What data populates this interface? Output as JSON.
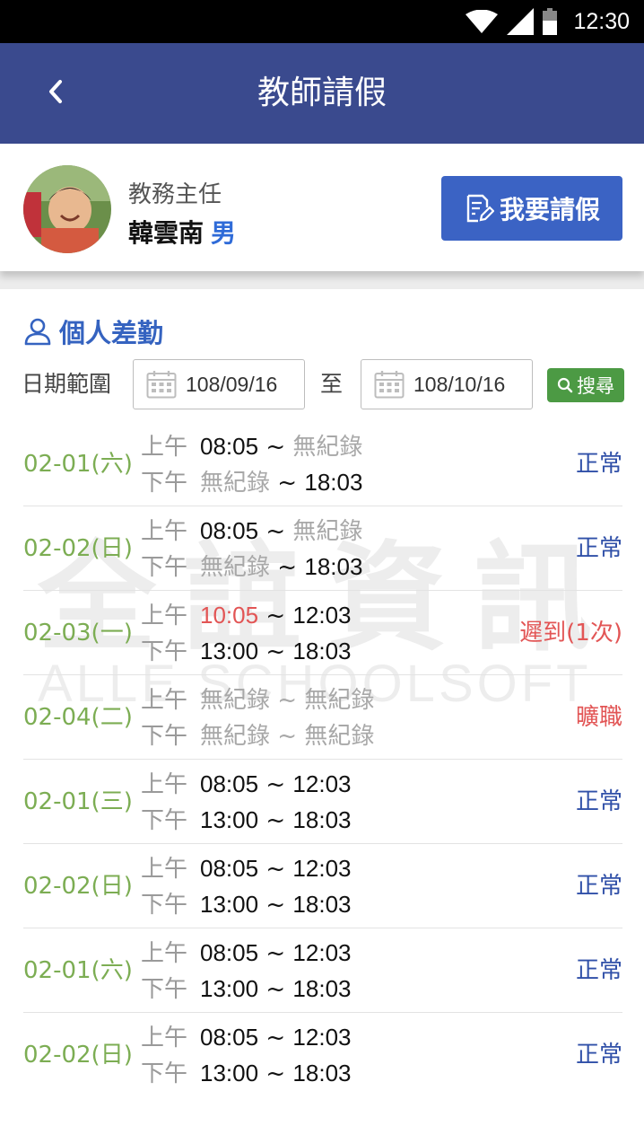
{
  "status_bar": {
    "time": "12:30",
    "icons": [
      "wifi-icon",
      "signal-icon",
      "battery-icon"
    ]
  },
  "app_bar": {
    "title": "教師請假",
    "back_icon": "chevron-left-icon"
  },
  "profile": {
    "role": "教務主任",
    "name": "韓雲南",
    "gender": "男",
    "leave_button": "我要請假"
  },
  "section": {
    "title": "個人差勤"
  },
  "filter": {
    "label": "日期範圍",
    "from": "108/09/16",
    "to_label": "至",
    "to": "108/10/16",
    "search_label": "搜尋"
  },
  "watermark": {
    "cn": "全誼資訊",
    "en": "ALLE SCHOOLSOFT"
  },
  "records": [
    {
      "date": "02-01(六)",
      "am_label": "上午",
      "am_in": "08:05",
      "am_sep": "~",
      "am_out": "無紀錄",
      "pm_label": "下午",
      "pm_in": "無紀錄",
      "pm_sep": "~",
      "pm_out": "18:03",
      "status": "正常"
    },
    {
      "date": "02-02(日)",
      "am_label": "上午",
      "am_in": "08:05",
      "am_sep": "~",
      "am_out": "無紀錄",
      "pm_label": "下午",
      "pm_in": "無紀錄",
      "pm_sep": "~",
      "pm_out": "18:03",
      "status": "正常"
    },
    {
      "date": "02-03(一)",
      "am_label": "上午",
      "am_in": "10:05",
      "am_sep": "~",
      "am_out": "12:03",
      "pm_label": "下午",
      "pm_in": "13:00",
      "pm_sep": "~",
      "pm_out": "18:03",
      "status": "遲到(1次)"
    },
    {
      "date": "02-04(二)",
      "am_label": "上午",
      "am_in": "無紀錄",
      "am_sep": "~",
      "am_out": "無紀錄",
      "pm_label": "下午",
      "pm_in": "無紀錄",
      "pm_sep": "~",
      "pm_out": "無紀錄",
      "status": "曠職"
    },
    {
      "date": "02-01(三)",
      "am_label": "上午",
      "am_in": "08:05",
      "am_sep": "~",
      "am_out": "12:03",
      "pm_label": "下午",
      "pm_in": "13:00",
      "pm_sep": "~",
      "pm_out": "18:03",
      "status": "正常"
    },
    {
      "date": "02-02(日)",
      "am_label": "上午",
      "am_in": "08:05",
      "am_sep": "~",
      "am_out": "12:03",
      "pm_label": "下午",
      "pm_in": "13:00",
      "pm_sep": "~",
      "pm_out": "18:03",
      "status": "正常"
    },
    {
      "date": "02-01(六)",
      "am_label": "上午",
      "am_in": "08:05",
      "am_sep": "~",
      "am_out": "12:03",
      "pm_label": "下午",
      "pm_in": "13:00",
      "pm_sep": "~",
      "pm_out": "18:03",
      "status": "正常"
    },
    {
      "date": "02-02(日)",
      "am_label": "上午",
      "am_in": "08:05",
      "am_sep": "~",
      "am_out": "12:03",
      "pm_label": "下午",
      "pm_in": "13:00",
      "pm_sep": "~",
      "pm_out": "18:03",
      "status": "正常"
    }
  ],
  "colors": {
    "header": "#3a4a8e",
    "accent": "#3b63c4",
    "date": "#7cad53",
    "normal": "#3050a8",
    "alert": "#e25555",
    "search": "#4c9a44"
  }
}
